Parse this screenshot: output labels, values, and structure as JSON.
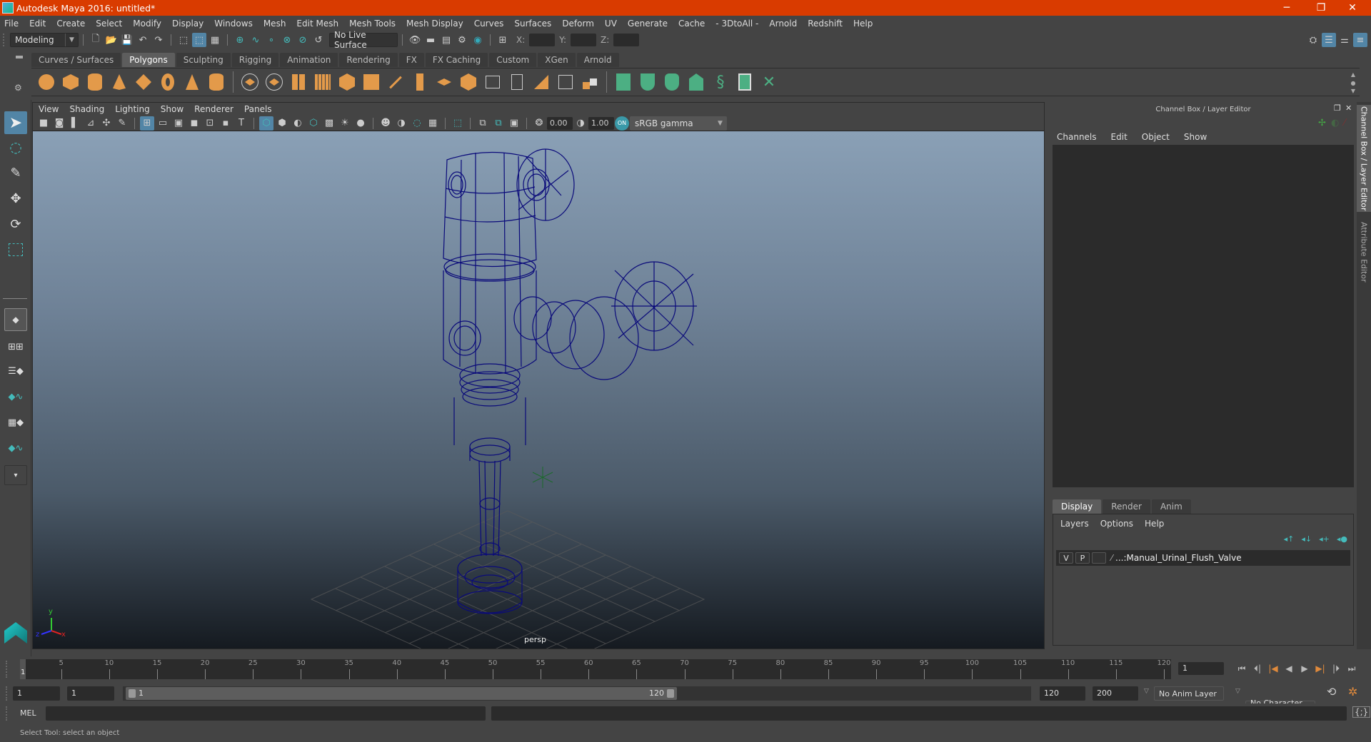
{
  "window": {
    "title": "Autodesk Maya 2016: untitled*",
    "controls": {
      "minimize": "─",
      "restore": "❐",
      "close": "✕"
    }
  },
  "menubar": [
    "File",
    "Edit",
    "Create",
    "Select",
    "Modify",
    "Display",
    "Windows",
    "Mesh",
    "Edit Mesh",
    "Mesh Tools",
    "Mesh Display",
    "Curves",
    "Surfaces",
    "Deform",
    "UV",
    "Generate",
    "Cache",
    "- 3DtoAll -",
    "Arnold",
    "Redshift",
    "Help"
  ],
  "statusline": {
    "menuset": "Modeling",
    "live_surface": "No Live Surface",
    "x_label": "X:",
    "y_label": "Y:",
    "z_label": "Z:",
    "x_value": "",
    "y_value": "",
    "z_value": ""
  },
  "shelf": {
    "tabs": [
      "Curves / Surfaces",
      "Polygons",
      "Sculpting",
      "Rigging",
      "Animation",
      "Rendering",
      "FX",
      "FX Caching",
      "Custom",
      "XGen",
      "Arnold"
    ],
    "active_tab": "Polygons",
    "icons": [
      "poly-sphere-icon",
      "poly-cube-icon",
      "poly-cylinder-icon",
      "poly-cone-icon",
      "poly-plane-icon",
      "poly-torus-icon",
      "poly-pyramid-icon",
      "poly-pipe-icon",
      "combine-icon",
      "separate-icon",
      "mirror-icon",
      "smooth-icon",
      "average-icon",
      "fill-hole-icon",
      "extrude-icon",
      "bridge-icon",
      "multi-cut-icon",
      "bevel-icon",
      "target-weld-icon",
      "connect-icon",
      "insert-edge-loop-icon",
      "offset-edge-loop-icon",
      "bevel-face-icon",
      "merge-center-icon",
      "planar-uv-icon",
      "automatic-uv-icon",
      "cylindrical-uv-icon",
      "spherical-uv-icon",
      "contour-uv-icon",
      "uv-editor-icon",
      "unfold-uv-icon"
    ]
  },
  "viewport": {
    "menus": [
      "View",
      "Shading",
      "Lighting",
      "Show",
      "Renderer",
      "Panels"
    ],
    "exposure": "0.00",
    "gamma": "1.00",
    "colorspace": "sRGB gamma",
    "camera_label": "persp",
    "axis": {
      "x": "x",
      "y": "y",
      "z": "z"
    }
  },
  "channel_box": {
    "header": "Channel Box / Layer Editor",
    "menus": [
      "Channels",
      "Edit",
      "Object",
      "Show"
    ]
  },
  "layer_editor": {
    "tabs": [
      "Display",
      "Render",
      "Anim"
    ],
    "active_tab": "Display",
    "menus": [
      "Layers",
      "Options",
      "Help"
    ],
    "layers": [
      {
        "visible": "V",
        "playback": "P",
        "name": "...:Manual_Urinal_Flush_Valve"
      }
    ]
  },
  "side_tabs": [
    "Channel Box / Layer Editor",
    "Attribute Editor"
  ],
  "timeline": {
    "start": 1,
    "end": 120,
    "current_frame": "1",
    "tick_labels": [
      "5",
      "10",
      "15",
      "20",
      "25",
      "30",
      "35",
      "40",
      "45",
      "50",
      "55",
      "60",
      "65",
      "70",
      "75",
      "80",
      "85",
      "90",
      "95",
      "100",
      "105",
      "110",
      "115",
      "120"
    ],
    "current_marker": "1"
  },
  "range": {
    "start_time": "1",
    "playback_start": "1",
    "slider_start": "1",
    "slider_end": "120",
    "playback_end": "120",
    "end_time": "200",
    "anim_layer": "No Anim Layer",
    "character_set": "No Character Set"
  },
  "command_line": {
    "language": "MEL",
    "value": ""
  },
  "help_line": "Select Tool: select an object",
  "colors": {
    "title_bar": "#d93b00",
    "accent": "#5285a6",
    "wireframe": "#0a0a7a",
    "shelf_icon": "#e39a4a",
    "uv_icon": "#4caf83"
  }
}
